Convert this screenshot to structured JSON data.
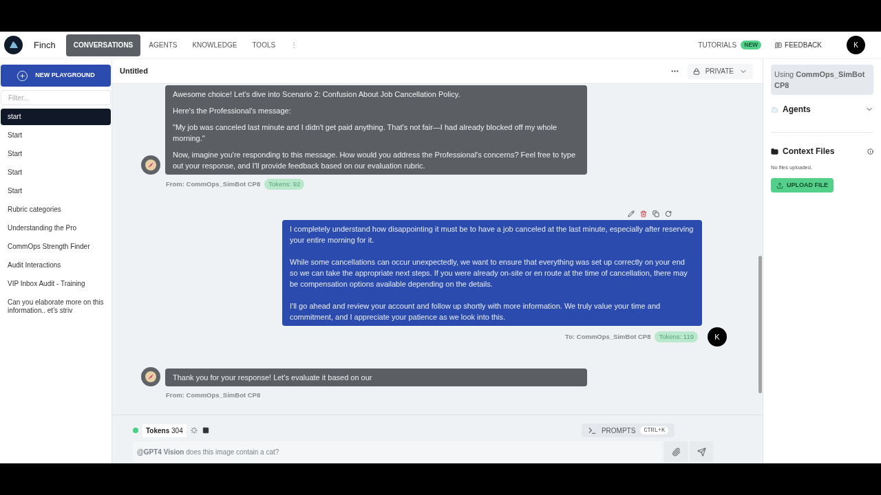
{
  "header": {
    "app_name": "Finch",
    "nav": [
      {
        "label": "CONVERSATIONS",
        "selected": true
      },
      {
        "label": "AGENTS",
        "selected": false
      },
      {
        "label": "KNOWLEDGE",
        "selected": false
      },
      {
        "label": "TOOLS",
        "selected": false
      },
      {
        "label": "⋮",
        "selected": false
      }
    ],
    "tutorials": "TUTORIALS",
    "new_badge": "NEW",
    "feedback": "FEEDBACK",
    "avatar": "K"
  },
  "sidebar": {
    "new_button": "NEW PLAYGROUND",
    "filter_placeholder": "Filter...",
    "items": [
      {
        "label": "start",
        "selected": true
      },
      {
        "label": "Start",
        "selected": false
      },
      {
        "label": "Start",
        "selected": false
      },
      {
        "label": "Start",
        "selected": false
      },
      {
        "label": "Start",
        "selected": false
      },
      {
        "label": "Rubric categories",
        "selected": false
      },
      {
        "label": "Understanding the Pro",
        "selected": false
      },
      {
        "label": "CommOps Strength Finder",
        "selected": false
      },
      {
        "label": "Audit Interactions",
        "selected": false
      },
      {
        "label": "VIP Inbox Audit - Training",
        "selected": false
      },
      {
        "label": "Can you elaborate more on this information.. et's striv",
        "selected": false
      }
    ]
  },
  "chat": {
    "title": "Untitled",
    "privacy": "PRIVATE",
    "messages": [
      {
        "kind": "bot",
        "paragraphs": [
          "Awesome choice! Let's dive into Scenario 2: Confusion About Job Cancellation Policy.",
          "Here's the Professional's message:",
          "\"My job was canceled last minute and I didn't get paid anything. That's not fair—I had already blocked off my whole morning.\"",
          "Now, imagine you're responding to this message. How would you address the Professional's concerns? Feel free to type out your response, and I'll provide feedback based on our evaluation rubric."
        ],
        "meta": "From: CommOps_SimBot CP8",
        "tokens": "Tokens: 92"
      },
      {
        "kind": "user",
        "paragraphs": [
          "I completely understand how disappointing it must be to have a job canceled at the last minute, especially after reserving your entire morning for it.",
          "While some cancellations can occur unexpectedly, we want to ensure that everything was set up correctly on your end so we can take the appropriate next steps. If you were already on-site or en route at the time of cancellation, there may be compensation options available depending on the details.",
          "I'll go ahead and review your account and follow up shortly with more information. We truly value your time and commitment, and I appreciate your patience as we look into this."
        ],
        "meta": "To: CommOps_SimBot CP8",
        "tokens": "Tokens: 119",
        "avatar": "K"
      },
      {
        "kind": "bot",
        "paragraphs": [
          "Thank you for your response! Let's evaluate it based on our"
        ],
        "meta": "From: CommOps_SimBot CP8"
      }
    ]
  },
  "composer": {
    "tokens": "**Tokens** 304",
    "prompts": "PROMPTS",
    "shortcut": "CTRL+K",
    "input": "**@GPT4 Vision** does this image contain a cat?"
  },
  "right_panel": {
    "using": "Using **CommOps_SimBot CP8**",
    "agents": "Agents",
    "context_title": "Context Files",
    "no_files": "No files uploaded.",
    "upload": "UPLOAD FILE"
  }
}
